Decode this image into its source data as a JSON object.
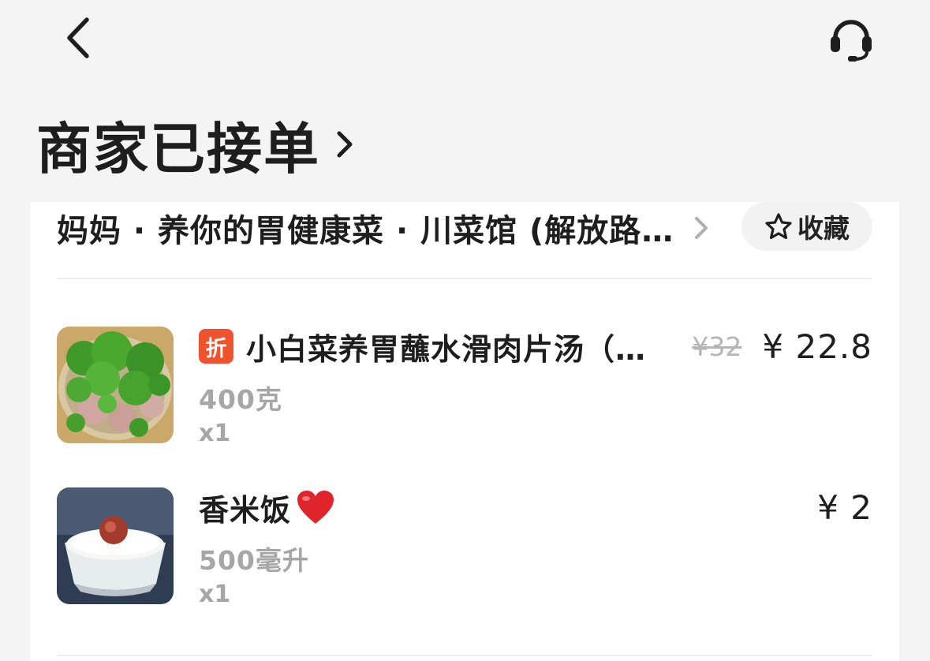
{
  "topbar": {
    "back_icon": "chevron-left-icon",
    "support_icon": "headset-icon"
  },
  "status": {
    "title": "商家已接单",
    "chevron_icon": "chevron-right-icon"
  },
  "shop": {
    "name": "妈妈 · 养你的胃健康菜 · 川菜馆 (解放路店)",
    "chevron_icon": "chevron-right-icon",
    "favorite": {
      "icon": "star-outline-icon",
      "label": "收藏"
    }
  },
  "items": [
    {
      "badge": "折",
      "name": "小白菜养胃蘸水滑肉片汤（份）",
      "spec": "400克",
      "qty": "x1",
      "original_price": "¥32",
      "price": "¥ 22.8",
      "thumb_icon": "food-photo-greens-pork-soup"
    },
    {
      "name": "香米饭",
      "emoji_icon": "red-heart-icon",
      "spec": "500毫升",
      "qty": "x1",
      "price": "¥ 2",
      "thumb_icon": "food-photo-rice-bowl"
    }
  ],
  "colors": {
    "page_bg": "#f4f4f4",
    "card_bg": "#ffffff",
    "discount_badge": "#f0522e",
    "muted_text": "#a6a6a6",
    "primary_text": "#1e1e1e"
  }
}
